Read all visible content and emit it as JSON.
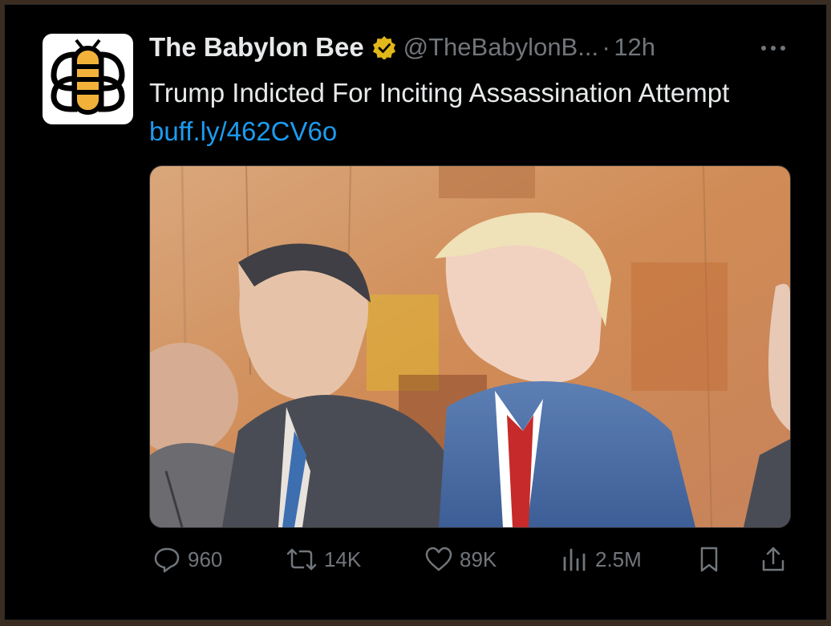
{
  "tweet": {
    "display_name": "The Babylon Bee",
    "handle": "@TheBabylonB...",
    "separator": "·",
    "time": "12h",
    "text": "Trump Indicted For Inciting Assassination Attempt ",
    "link": "buff.ly/462CV6o"
  },
  "icons": {
    "avatar": "bee-logo-icon",
    "verified": "verified-badge-icon",
    "more": "more-options-icon",
    "reply": "reply-icon",
    "retweet": "retweet-icon",
    "like": "heart-icon",
    "views": "views-icon",
    "bookmark": "bookmark-icon",
    "share": "share-icon"
  },
  "stats": {
    "replies": "960",
    "retweets": "14K",
    "likes": "89K",
    "views": "2.5M"
  },
  "colors": {
    "background": "#000000",
    "text": "#e7e9ea",
    "muted": "#71767b",
    "link": "#1d9bf0",
    "verified_gold": "#e2b719",
    "bee_yellow": "#f2b23a"
  }
}
